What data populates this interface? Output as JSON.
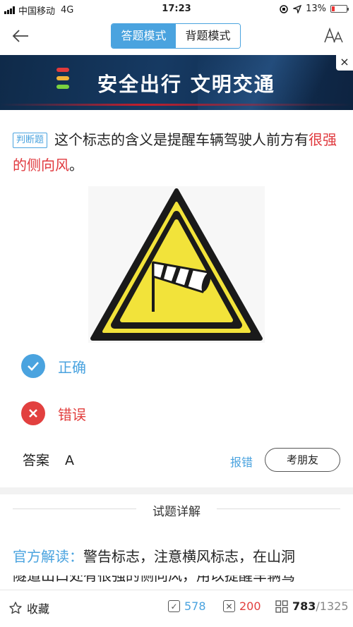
{
  "status": {
    "carrier": "中国移动",
    "network": "4G",
    "time": "17:23",
    "battery": "13%"
  },
  "header": {
    "tabs": [
      {
        "label": "答题模式",
        "active": true
      },
      {
        "label": "背题模式",
        "active": false
      }
    ]
  },
  "banner": {
    "text": "安全出行  文明交通",
    "close": "×"
  },
  "question": {
    "tag": "判断题",
    "text_before": "这个标志的含义是提醒车辆驾驶人前方有",
    "text_highlight": "很强的侧向风",
    "text_after": "。"
  },
  "options": [
    {
      "label": "正确",
      "state": "correct"
    },
    {
      "label": "错误",
      "state": "wrong"
    }
  ],
  "answer": {
    "label": "答案",
    "value": "A",
    "report": "报错",
    "friend_button": "考朋友"
  },
  "detail": {
    "title": "试题详解",
    "lead": "官方解读：",
    "text": "警告标志，注意横风标志，在山洞",
    "text_next": "隧道出口处有很强的侧向风，用以提醒车辆驾"
  },
  "bottom": {
    "favorite": "收藏",
    "correct_count": "578",
    "wrong_count": "200",
    "current": "783",
    "total": "/1325"
  },
  "colors": {
    "accent": "#4aa3df",
    "error": "#e2403f",
    "sign_yellow": "#f2e33a"
  }
}
